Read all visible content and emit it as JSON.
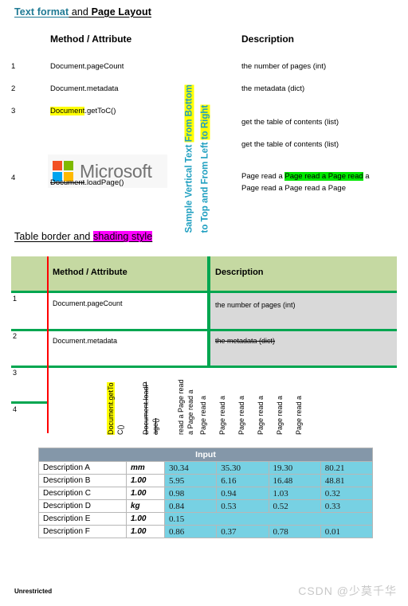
{
  "page": {
    "footer_note": "Unrestricted",
    "watermark": "CSDN @少莫千华"
  },
  "section1": {
    "title": {
      "part1": "Text format",
      "part2": " and ",
      "part3": "Page Layout"
    },
    "headers": {
      "method": "Method / Attribute",
      "description": "Description"
    },
    "rows": [
      {
        "num": "1",
        "method": "Document.pageCount",
        "description": "the number of pages (int)"
      },
      {
        "num": "2",
        "method": "Document.metadata",
        "description": "the metadata (dict)"
      },
      {
        "num": "3",
        "method_hl": "Document",
        "method_rest": ".getToC()",
        "description": "get the table of contents (list)"
      },
      {
        "num": "",
        "method": "",
        "description": "get the table of contents (list)"
      },
      {
        "num": "4",
        "method_strike": "Document",
        "method_rest": ".loadPage()",
        "description": ""
      }
    ],
    "logo": {
      "word": "Microsoft",
      "colors": {
        "top_left": "#f25022",
        "top_right": "#7fba00",
        "bottom_left": "#00a4ef",
        "bottom_right": "#ffb900"
      }
    },
    "desc_last": {
      "line1_pre": "Page read a ",
      "line1_hl": "Page read a Page read",
      "line1_post": " a",
      "line2": "Page read a Page read a Page"
    },
    "vertical_text": {
      "line_a": "Sample Vertical Text From Bottom",
      "line_a_plain": "Sample Vertical Text ",
      "line_a_hl": "From Bottom",
      "line_b_plain": "to Top and From Left ",
      "line_b_hl": "to Right",
      "color": "#1f9fc0"
    }
  },
  "section2": {
    "title": {
      "part1": "Table border and ",
      "part2": "shading style"
    },
    "headers": {
      "method": "Method / Attribute",
      "description": "Description"
    },
    "rows": [
      {
        "num": "1",
        "method": "Document.pageCount",
        "description": "the number of pages (int)",
        "desc_strike": false
      },
      {
        "num": "2",
        "method": "Document.metadata",
        "description": "the metadata (dict)",
        "desc_strike": true
      },
      {
        "num": "3",
        "method": "",
        "description": "",
        "desc_strike": false
      },
      {
        "num": "4",
        "method": "",
        "description": "",
        "desc_strike": false
      }
    ],
    "vertical_columns": [
      {
        "line1": "Document.getTo",
        "line2": "C()",
        "style": "highlight"
      },
      {
        "line1": "Document.loadP",
        "line2": "age()",
        "style": "strike"
      },
      {
        "line1": "read a Page read",
        "line2": "a Page read a",
        "style": "plain"
      },
      {
        "line1": "Page read a",
        "line2": "",
        "style": "plain"
      },
      {
        "line1": "Page read a",
        "line2": "",
        "style": "plain"
      },
      {
        "line1": "Page read a",
        "line2": "",
        "style": "plain"
      },
      {
        "line1": "Page read a",
        "line2": "",
        "style": "plain"
      },
      {
        "line1": "Page read a",
        "line2": "",
        "style": "plain"
      },
      {
        "line1": "Page read a",
        "line2": "",
        "style": "plain"
      }
    ],
    "border_colors": {
      "horizontal": "#00a650",
      "vertical_red": "#ff0000",
      "header_fill": "#c5d9a2",
      "desc_fill": "#d9d9d9"
    }
  },
  "section3": {
    "header": "Input",
    "rows": [
      {
        "description": "Description A",
        "unit": "mm",
        "values": [
          "30.34",
          "35.30",
          "19.30",
          "80.21"
        ]
      },
      {
        "description": "Description B",
        "unit": "1.00",
        "values": [
          "5.95",
          "6.16",
          "16.48",
          "48.81"
        ]
      },
      {
        "description": "Description C",
        "unit": "1.00",
        "values": [
          "0.98",
          "0.94",
          "1.03",
          "0.32"
        ]
      },
      {
        "description": "Description D",
        "unit": "kg",
        "values": [
          "0.84",
          "0.53",
          "0.52",
          "0.33"
        ]
      },
      {
        "description": "Description E",
        "unit": "1.00",
        "values": [
          "0.15"
        ]
      },
      {
        "description": "Description F",
        "unit": "1.00",
        "values": [
          "0.86",
          "0.37",
          "0.78",
          "0.01"
        ]
      }
    ],
    "colors": {
      "header_fill": "#8497a9",
      "value_fill": "#77d1e3"
    }
  }
}
